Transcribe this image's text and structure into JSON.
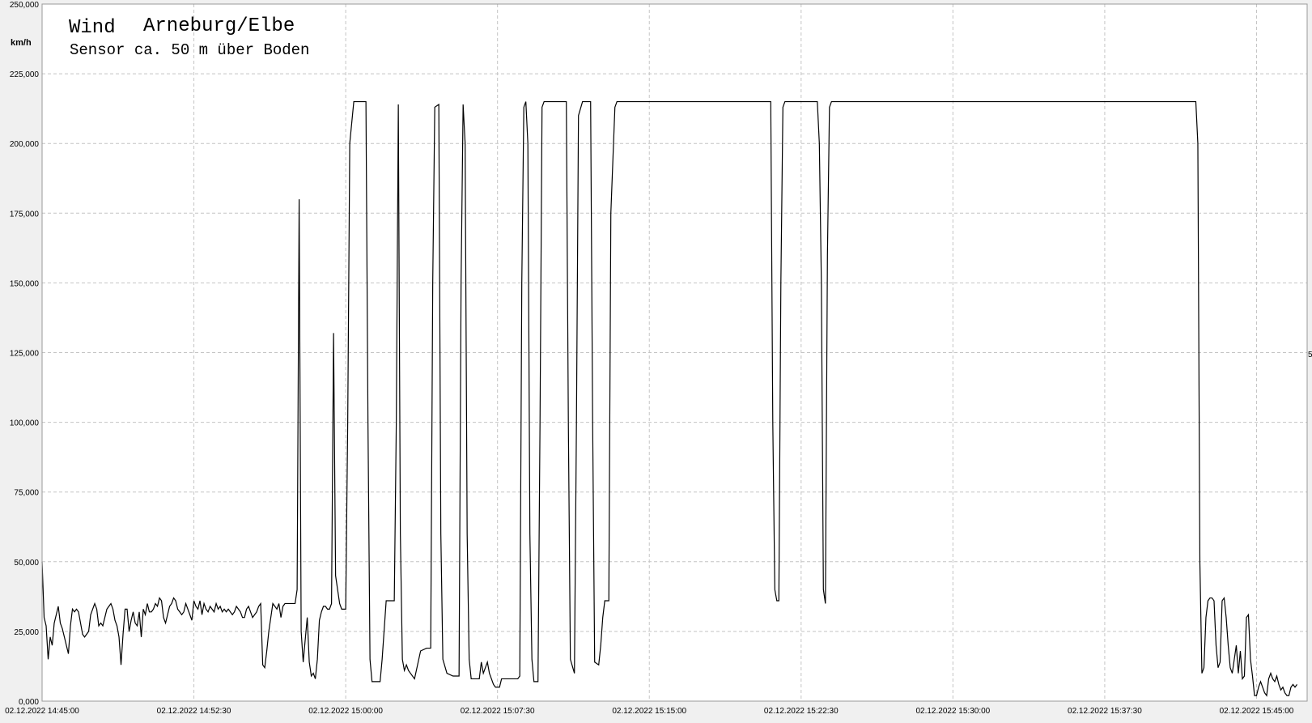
{
  "chart_data": {
    "type": "line",
    "title_word": "Wind",
    "title_place": "Arneburg/Elbe",
    "subtitle": "Sensor ca. 50 m über Boden",
    "ylabel": "km/h",
    "ylim": [
      0,
      250
    ],
    "grid": true,
    "y_ticks": [
      {
        "value": 0,
        "label": "0,000"
      },
      {
        "value": 25,
        "label": "25,000"
      },
      {
        "value": 50,
        "label": "50,000"
      },
      {
        "value": 75,
        "label": "75,000"
      },
      {
        "value": 100,
        "label": "100,000"
      },
      {
        "value": 125,
        "label": "125,000"
      },
      {
        "value": 150,
        "label": "150,000"
      },
      {
        "value": 175,
        "label": "175,000"
      },
      {
        "value": 200,
        "label": "200,000"
      },
      {
        "value": 225,
        "label": "225,000"
      },
      {
        "value": 250,
        "label": "250,000"
      }
    ],
    "x_ticks": [
      {
        "minutes": 0,
        "label": "02.12.2022   14:45:00"
      },
      {
        "minutes": 7.5,
        "label": "02.12.2022   14:52:30"
      },
      {
        "minutes": 15,
        "label": "02.12.2022   15:00:00"
      },
      {
        "minutes": 22.5,
        "label": "02.12.2022   15:07:30"
      },
      {
        "minutes": 30,
        "label": "02.12.2022   15:15:00"
      },
      {
        "minutes": 37.5,
        "label": "02.12.2022   15:22:30"
      },
      {
        "minutes": 45,
        "label": "02.12.2022   15:30:00"
      },
      {
        "minutes": 52.5,
        "label": "02.12.2022   15:37:30"
      },
      {
        "minutes": 60,
        "label": "02.12.2022   15:45:00"
      }
    ],
    "series": [
      {
        "color": "#000000",
        "points": [
          [
            0.0,
            50
          ],
          [
            0.1,
            30
          ],
          [
            0.2,
            27
          ],
          [
            0.3,
            15
          ],
          [
            0.4,
            23
          ],
          [
            0.5,
            20
          ],
          [
            0.6,
            28
          ],
          [
            0.7,
            31
          ],
          [
            0.8,
            34
          ],
          [
            0.9,
            28
          ],
          [
            1.0,
            26
          ],
          [
            1.1,
            23
          ],
          [
            1.2,
            20
          ],
          [
            1.3,
            17
          ],
          [
            1.4,
            27
          ],
          [
            1.5,
            33
          ],
          [
            1.6,
            32
          ],
          [
            1.7,
            33
          ],
          [
            1.8,
            32
          ],
          [
            1.9,
            28
          ],
          [
            2.0,
            24
          ],
          [
            2.1,
            23
          ],
          [
            2.2,
            24
          ],
          [
            2.3,
            25
          ],
          [
            2.4,
            31
          ],
          [
            2.5,
            33
          ],
          [
            2.6,
            35
          ],
          [
            2.7,
            33
          ],
          [
            2.8,
            27
          ],
          [
            2.9,
            28
          ],
          [
            3.0,
            27
          ],
          [
            3.1,
            30
          ],
          [
            3.2,
            33
          ],
          [
            3.3,
            34
          ],
          [
            3.4,
            35
          ],
          [
            3.5,
            33
          ],
          [
            3.6,
            29
          ],
          [
            3.7,
            27
          ],
          [
            3.8,
            23
          ],
          [
            3.9,
            13
          ],
          [
            4.0,
            24
          ],
          [
            4.1,
            33
          ],
          [
            4.2,
            33
          ],
          [
            4.3,
            25
          ],
          [
            4.4,
            29
          ],
          [
            4.5,
            32
          ],
          [
            4.6,
            28
          ],
          [
            4.7,
            27
          ],
          [
            4.8,
            32
          ],
          [
            4.9,
            23
          ],
          [
            5.0,
            33
          ],
          [
            5.1,
            31
          ],
          [
            5.2,
            35
          ],
          [
            5.3,
            32
          ],
          [
            5.4,
            32
          ],
          [
            5.5,
            33
          ],
          [
            5.6,
            35
          ],
          [
            5.7,
            34
          ],
          [
            5.8,
            37
          ],
          [
            5.9,
            36
          ],
          [
            6.0,
            30
          ],
          [
            6.1,
            28
          ],
          [
            6.2,
            31
          ],
          [
            6.3,
            34
          ],
          [
            6.4,
            35
          ],
          [
            6.5,
            37
          ],
          [
            6.6,
            36
          ],
          [
            6.7,
            33
          ],
          [
            6.8,
            32
          ],
          [
            6.9,
            31
          ],
          [
            7.0,
            32
          ],
          [
            7.1,
            35
          ],
          [
            7.2,
            33
          ],
          [
            7.3,
            31
          ],
          [
            7.4,
            29
          ],
          [
            7.5,
            36
          ],
          [
            7.6,
            34
          ],
          [
            7.7,
            33
          ],
          [
            7.8,
            36
          ],
          [
            7.9,
            31
          ],
          [
            8.0,
            35
          ],
          [
            8.1,
            33
          ],
          [
            8.2,
            32
          ],
          [
            8.3,
            34
          ],
          [
            8.4,
            33
          ],
          [
            8.5,
            32
          ],
          [
            8.6,
            35
          ],
          [
            8.7,
            33
          ],
          [
            8.8,
            34
          ],
          [
            8.9,
            32
          ],
          [
            9.0,
            33
          ],
          [
            9.1,
            32
          ],
          [
            9.2,
            33
          ],
          [
            9.3,
            32
          ],
          [
            9.4,
            31
          ],
          [
            9.5,
            32
          ],
          [
            9.6,
            34
          ],
          [
            9.7,
            33
          ],
          [
            9.8,
            32
          ],
          [
            9.9,
            30
          ],
          [
            10.0,
            30
          ],
          [
            10.1,
            33
          ],
          [
            10.2,
            34
          ],
          [
            10.3,
            32
          ],
          [
            10.4,
            30
          ],
          [
            10.5,
            31
          ],
          [
            10.6,
            32
          ],
          [
            10.7,
            34
          ],
          [
            10.8,
            35
          ],
          [
            10.9,
            13
          ],
          [
            11.0,
            12
          ],
          [
            11.1,
            18
          ],
          [
            11.2,
            25
          ],
          [
            11.3,
            30
          ],
          [
            11.4,
            35
          ],
          [
            11.5,
            34
          ],
          [
            11.6,
            33
          ],
          [
            11.7,
            35
          ],
          [
            11.8,
            30
          ],
          [
            11.9,
            34
          ],
          [
            12.0,
            35
          ],
          [
            12.1,
            35
          ],
          [
            12.2,
            35
          ],
          [
            12.3,
            35
          ],
          [
            12.4,
            35
          ],
          [
            12.5,
            35
          ],
          [
            12.6,
            40
          ],
          [
            12.7,
            180
          ],
          [
            12.8,
            25
          ],
          [
            12.9,
            14
          ],
          [
            13.0,
            22
          ],
          [
            13.1,
            30
          ],
          [
            13.2,
            14
          ],
          [
            13.3,
            9
          ],
          [
            13.4,
            10
          ],
          [
            13.5,
            8
          ],
          [
            13.6,
            15
          ],
          [
            13.7,
            29
          ],
          [
            13.8,
            32
          ],
          [
            13.9,
            34
          ],
          [
            14.0,
            34
          ],
          [
            14.1,
            33
          ],
          [
            14.2,
            33
          ],
          [
            14.3,
            35
          ],
          [
            14.4,
            132
          ],
          [
            14.5,
            45
          ],
          [
            14.6,
            40
          ],
          [
            14.7,
            35
          ],
          [
            14.8,
            33
          ],
          [
            14.9,
            33
          ],
          [
            15.0,
            33
          ],
          [
            15.1,
            100
          ],
          [
            15.2,
            200
          ],
          [
            15.4,
            215
          ],
          [
            16.0,
            215
          ],
          [
            16.1,
            100
          ],
          [
            16.2,
            15
          ],
          [
            16.3,
            7
          ],
          [
            16.7,
            7
          ],
          [
            16.8,
            15
          ],
          [
            17.0,
            36
          ],
          [
            17.4,
            36
          ],
          [
            17.5,
            100
          ],
          [
            17.6,
            214
          ],
          [
            17.7,
            60
          ],
          [
            17.8,
            15
          ],
          [
            17.9,
            11
          ],
          [
            18.0,
            13
          ],
          [
            18.1,
            11
          ],
          [
            18.2,
            10
          ],
          [
            18.4,
            8
          ],
          [
            18.7,
            18
          ],
          [
            19.0,
            19
          ],
          [
            19.2,
            19
          ],
          [
            19.3,
            150
          ],
          [
            19.4,
            213
          ],
          [
            19.6,
            214
          ],
          [
            19.7,
            60
          ],
          [
            19.8,
            15
          ],
          [
            20.0,
            10
          ],
          [
            20.3,
            9
          ],
          [
            20.6,
            9
          ],
          [
            20.7,
            150
          ],
          [
            20.8,
            214
          ],
          [
            20.9,
            200
          ],
          [
            21.0,
            60
          ],
          [
            21.1,
            15
          ],
          [
            21.2,
            8
          ],
          [
            21.4,
            8
          ],
          [
            21.6,
            8
          ],
          [
            21.7,
            14
          ],
          [
            21.8,
            10
          ],
          [
            21.9,
            12
          ],
          [
            22.0,
            14
          ],
          [
            22.1,
            10
          ],
          [
            22.2,
            8
          ],
          [
            22.3,
            6
          ],
          [
            22.4,
            5
          ],
          [
            22.6,
            5
          ],
          [
            22.7,
            8
          ],
          [
            23.0,
            8
          ],
          [
            23.5,
            8
          ],
          [
            23.6,
            9
          ],
          [
            23.7,
            150
          ],
          [
            23.8,
            213
          ],
          [
            23.9,
            215
          ],
          [
            24.0,
            200
          ],
          [
            24.1,
            60
          ],
          [
            24.2,
            15
          ],
          [
            24.3,
            7
          ],
          [
            24.5,
            7
          ],
          [
            24.6,
            100
          ],
          [
            24.7,
            213
          ],
          [
            24.8,
            215
          ],
          [
            25.0,
            215
          ],
          [
            25.9,
            215
          ],
          [
            26.0,
            100
          ],
          [
            26.1,
            15
          ],
          [
            26.3,
            10
          ],
          [
            26.4,
            100
          ],
          [
            26.5,
            210
          ],
          [
            26.7,
            215
          ],
          [
            27.1,
            215
          ],
          [
            27.2,
            100
          ],
          [
            27.3,
            14
          ],
          [
            27.5,
            13
          ],
          [
            27.6,
            20
          ],
          [
            27.7,
            30
          ],
          [
            27.8,
            36
          ],
          [
            28.0,
            36
          ],
          [
            28.1,
            175
          ],
          [
            28.3,
            213
          ],
          [
            28.4,
            215
          ],
          [
            36.0,
            215
          ],
          [
            36.1,
            100
          ],
          [
            36.2,
            40
          ],
          [
            36.3,
            36
          ],
          [
            36.4,
            36
          ],
          [
            36.5,
            150
          ],
          [
            36.6,
            213
          ],
          [
            36.7,
            215
          ],
          [
            38.3,
            215
          ],
          [
            38.4,
            200
          ],
          [
            38.5,
            150
          ],
          [
            38.6,
            40
          ],
          [
            38.7,
            35
          ],
          [
            38.8,
            160
          ],
          [
            38.9,
            213
          ],
          [
            39.0,
            215
          ],
          [
            57.0,
            215
          ],
          [
            57.1,
            200
          ],
          [
            57.2,
            50
          ],
          [
            57.3,
            10
          ],
          [
            57.4,
            12
          ],
          [
            57.5,
            30
          ],
          [
            57.6,
            36
          ],
          [
            57.7,
            37
          ],
          [
            57.8,
            37
          ],
          [
            57.9,
            36
          ],
          [
            58.0,
            20
          ],
          [
            58.1,
            12
          ],
          [
            58.2,
            14
          ],
          [
            58.3,
            36
          ],
          [
            58.4,
            37
          ],
          [
            58.5,
            30
          ],
          [
            58.6,
            20
          ],
          [
            58.7,
            12
          ],
          [
            58.8,
            10
          ],
          [
            58.9,
            15
          ],
          [
            59.0,
            20
          ],
          [
            59.1,
            10
          ],
          [
            59.2,
            18
          ],
          [
            59.3,
            8
          ],
          [
            59.4,
            9
          ],
          [
            59.5,
            30
          ],
          [
            59.6,
            31
          ],
          [
            59.7,
            15
          ],
          [
            59.8,
            9
          ],
          [
            59.9,
            2
          ],
          [
            60.0,
            2
          ],
          [
            60.1,
            5
          ],
          [
            60.2,
            7
          ],
          [
            60.3,
            5
          ],
          [
            60.4,
            3
          ],
          [
            60.5,
            2
          ],
          [
            60.6,
            8
          ],
          [
            60.7,
            10
          ],
          [
            60.8,
            8
          ],
          [
            60.9,
            7
          ],
          [
            61.0,
            9
          ],
          [
            61.1,
            6
          ],
          [
            61.2,
            4
          ],
          [
            61.3,
            5
          ],
          [
            61.4,
            3
          ],
          [
            61.5,
            2
          ],
          [
            61.6,
            2
          ],
          [
            61.7,
            5
          ],
          [
            61.8,
            6
          ],
          [
            61.9,
            5
          ],
          [
            62.0,
            6
          ]
        ]
      }
    ],
    "right_edge_label": "5"
  }
}
